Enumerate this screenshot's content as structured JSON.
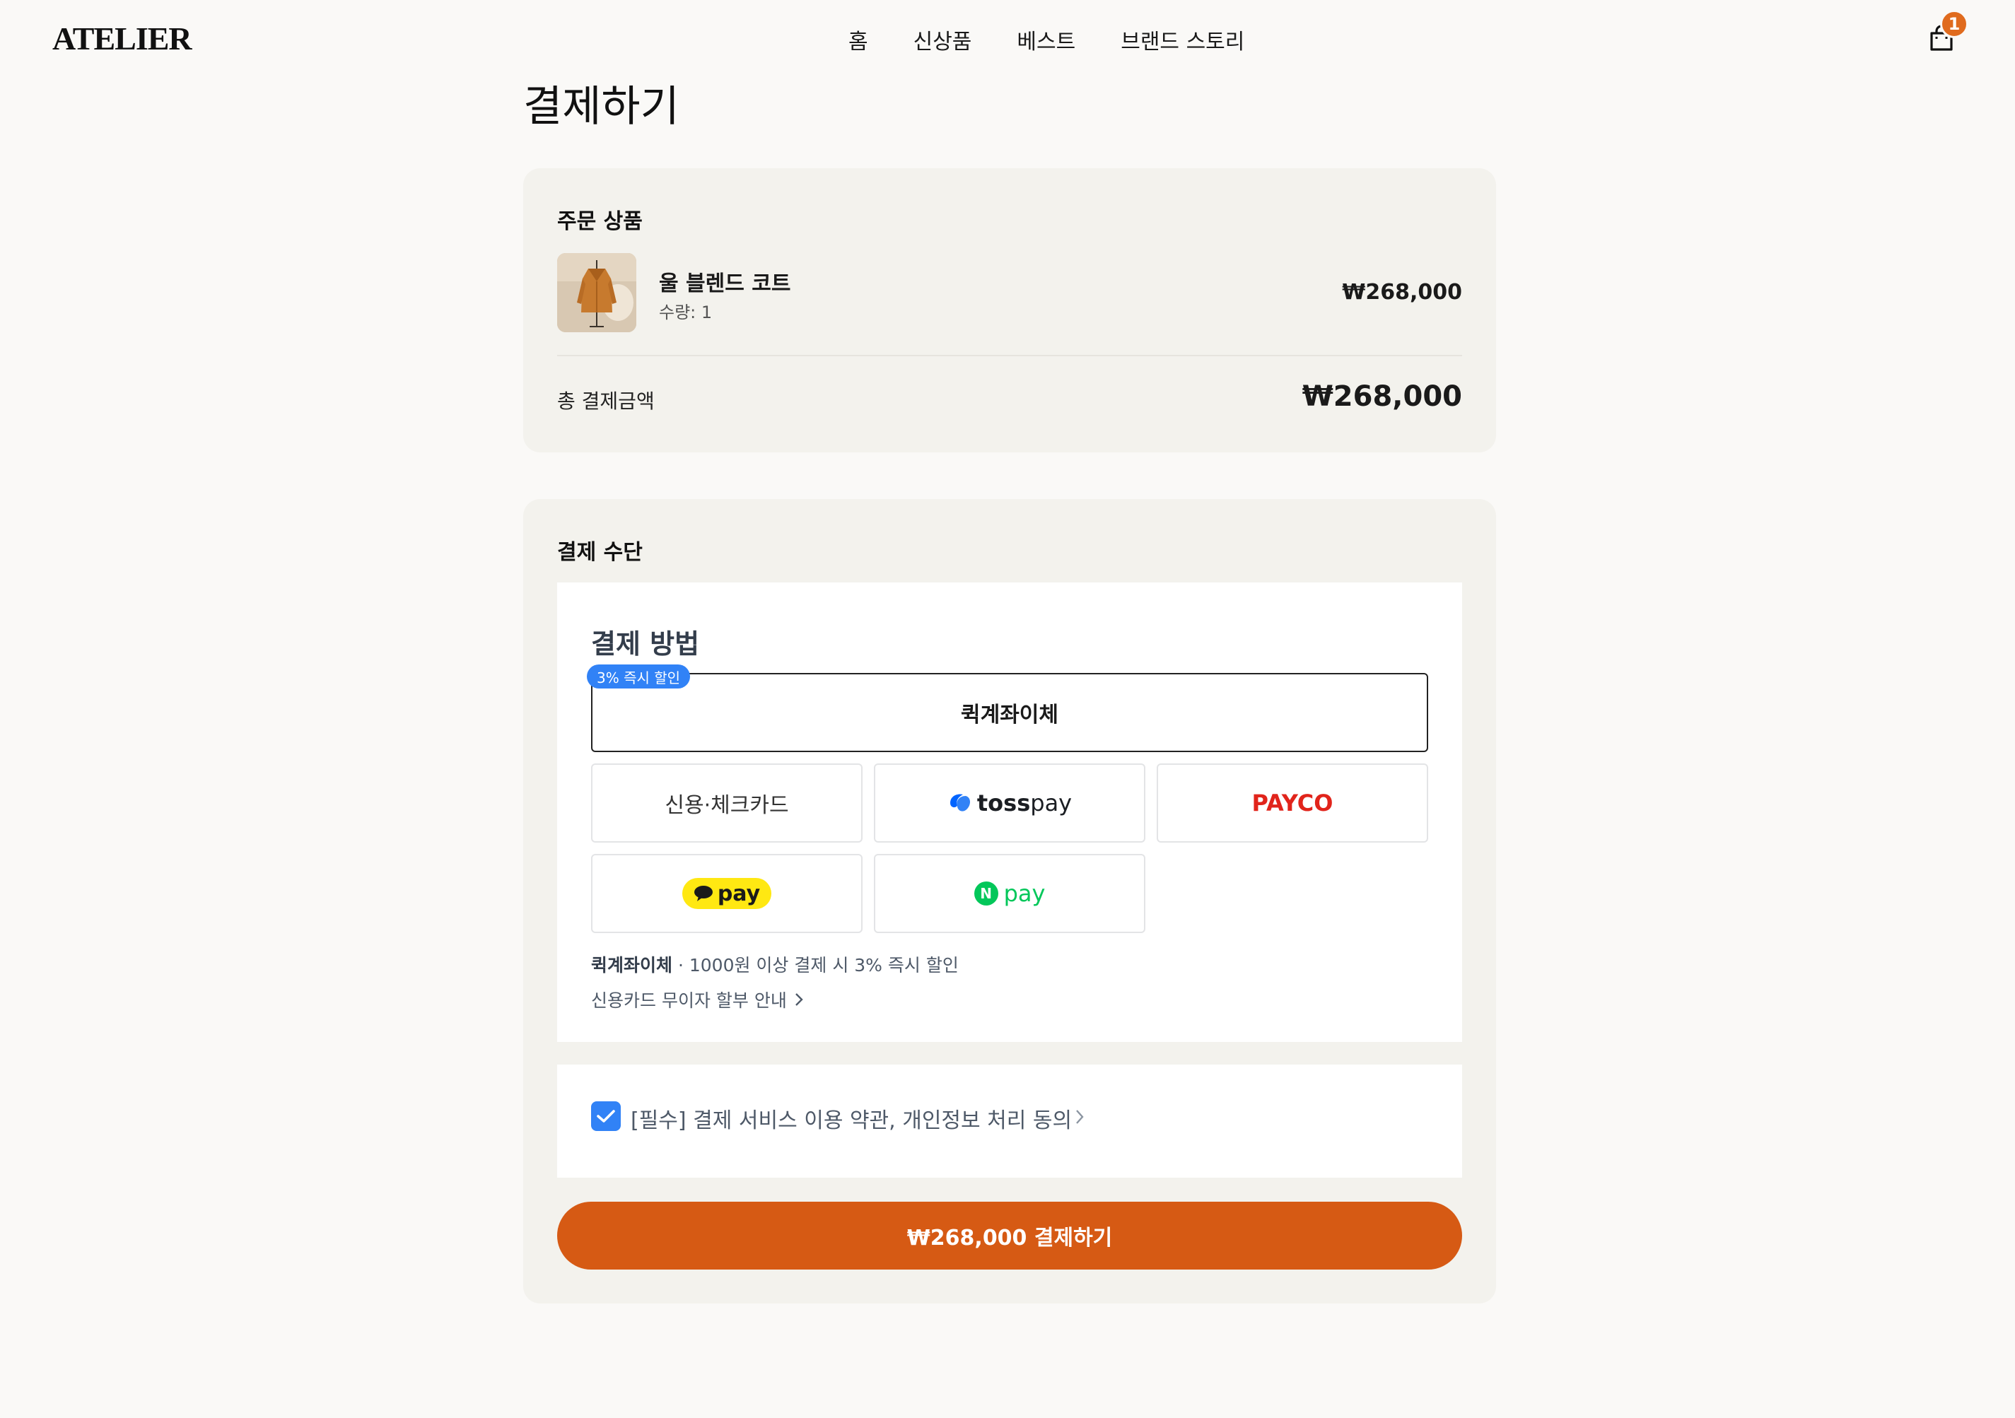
{
  "header": {
    "logo": "ATELIER",
    "nav": [
      "홈",
      "신상품",
      "베스트",
      "브랜드 스토리"
    ],
    "cart_count": "1"
  },
  "page_title": "결제하기",
  "order": {
    "section_label": "주문 상품",
    "product_name": "울 블렌드 코트",
    "product_qty": "수량: 1",
    "product_price": "₩268,000",
    "total_label": "총 결제금액",
    "total_value": "₩268,000"
  },
  "payment": {
    "section_label": "결제 수단",
    "title": "결제 방법",
    "discount_badge": "3% 즉시 할인",
    "quick_transfer": "퀵계좌이체",
    "credit_card": "신용·체크카드",
    "toss_bold": "toss",
    "toss_light": "pay",
    "payco": "PAYCO",
    "kakao": "pay",
    "npay_n": "N",
    "npay": "pay",
    "note_bold": "퀵계좌이체",
    "note_rest": " · 1000원 이상 결제 시 3% 즉시 할인",
    "installment": "신용카드 무이자 할부 안내"
  },
  "agreement": {
    "text": "[필수] 결제 서비스 이용 약관, 개인정보 처리 동의"
  },
  "pay_button": "₩268,000 결제하기",
  "colors": {
    "accent": "#d65a14",
    "blue": "#3182f6",
    "background": "#faf9f7",
    "card": "#f3f2ed"
  }
}
